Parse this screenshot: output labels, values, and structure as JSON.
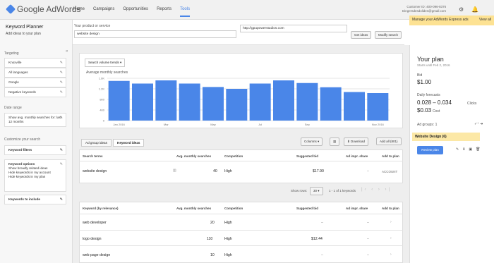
{
  "topbar": {
    "logo": "Google AdWords",
    "nav": [
      "Home",
      "Campaigns",
      "Opportunities",
      "Reports",
      "Tools"
    ],
    "customer_id": "Customer ID: 400-096-8376",
    "customer_email": "Dingersdesdolides@gmail.com"
  },
  "left": {
    "title": "Keyword Planner",
    "subtitle": "Add ideas to your plan",
    "targeting_label": "Targeting",
    "targeting": [
      "Knoxville",
      "All languages",
      "Google",
      "Negative keywords"
    ],
    "date_range_label": "Date range",
    "date_range": "Show avg. monthly searches for: last 12 months",
    "customize_label": "Customize your search",
    "keyword_filters": "Keyword filters",
    "keyword_options_title": "Keyword options",
    "keyword_options": [
      "Show broadly related ideas",
      "Hide keywords in my account",
      "Hide keywords in my plan"
    ],
    "keywords_include": "Keywords to include"
  },
  "productbar": {
    "label": "Your product or service",
    "service_value": "website design",
    "url_value": "http://gpupowerstudios.com",
    "get_ideas": "Get ideas",
    "modify_search": "Modify search"
  },
  "notice": {
    "text": "Manage your AdWords Express ads",
    "view_all": "View all"
  },
  "chart": {
    "selector": "Search volume trends",
    "title": "Average monthly searches",
    "xlabels": [
      "Jan 2016",
      "Mar",
      "May",
      "Jul",
      "Sep",
      "Nov 2016"
    ],
    "ylabels": [
      "1.6K",
      "1.2K",
      "800",
      "400",
      "0"
    ]
  },
  "chart_data": {
    "type": "bar",
    "title": "Average monthly searches",
    "ylim": [
      0,
      1600
    ],
    "categories": [
      "Jan 2016",
      "Feb",
      "Mar",
      "Apr",
      "May",
      "Jun",
      "Jul",
      "Aug",
      "Sep",
      "Oct",
      "Nov",
      "Dec 2016"
    ],
    "values": [
      1500,
      1400,
      1520,
      1400,
      1270,
      1200,
      1400,
      1520,
      1420,
      1260,
      1080,
      1040
    ],
    "color": "#4a86e8"
  },
  "tabs": [
    "Ad group ideas",
    "Keyword ideas"
  ],
  "tools": {
    "columns": "Columns",
    "download": "Download",
    "add_all": "Add all (801)"
  },
  "search_table": {
    "headers": [
      "Search terms",
      "Avg. monthly searches",
      "Competition",
      "Suggested bid",
      "Ad impr. share",
      "Add to plan"
    ],
    "rows": [
      {
        "term": "website design",
        "searches": "40",
        "competition": "High",
        "bid": "$17.90",
        "impr": "–",
        "add": "ACCOUNT"
      }
    ]
  },
  "pager": {
    "show_rows": "Show rows:",
    "rows": "30",
    "range": "1 - 1 of 1 keywords"
  },
  "kw_table": {
    "headers": [
      "Keyword (by relevance)",
      "Avg. monthly searches",
      "Competition",
      "Suggested bid",
      "Ad impr. share",
      "Add to plan"
    ],
    "rows": [
      {
        "term": "web developer",
        "searches": "20",
        "competition": "High",
        "bid": "–",
        "impr": "–"
      },
      {
        "term": "logo design",
        "searches": "110",
        "competition": "High",
        "bid": "$12.44",
        "impr": "–"
      },
      {
        "term": "web page design",
        "searches": "10",
        "competition": "High",
        "bid": "–",
        "impr": "–"
      }
    ]
  },
  "plan": {
    "title": "Your plan",
    "subtitle": "Starts until Feb 2, 2016",
    "bid_label": "Bid",
    "bid": "$1.00",
    "daily_label": "Daily forecasts",
    "range": "0.028 – 0.034",
    "range_unit": "Clicks",
    "cost": "$0.03",
    "cost_unit": "Cost",
    "adgroups_label": "Ad groups: 1",
    "adgroup": "Website Design (6)",
    "review": "Review plan"
  }
}
